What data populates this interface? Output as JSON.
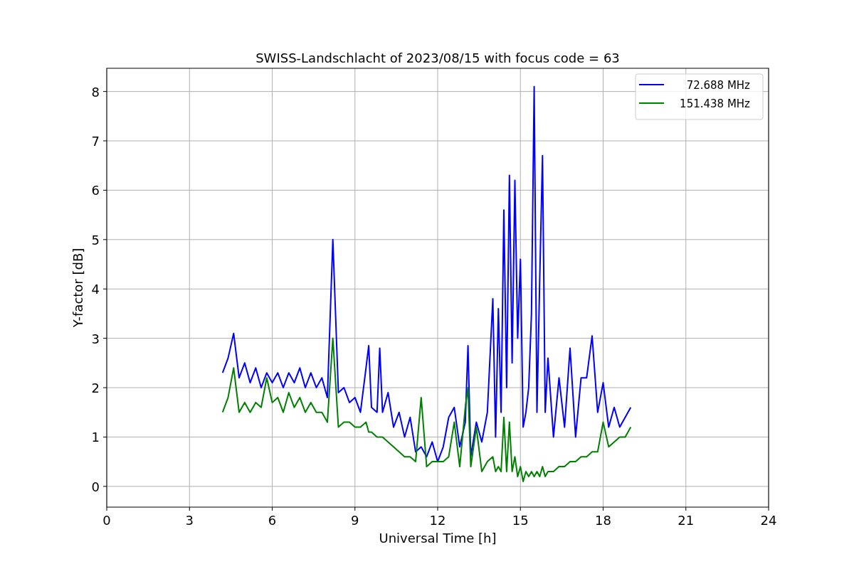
{
  "plot": {
    "chart_data": {
      "type": "line",
      "title": "SWISS-Landschlacht of 2023/08/15 with focus code = 63",
      "xlabel": "Universal Time [h]",
      "ylabel": "Y-factor [dB]",
      "x": [
        4.2,
        4.4,
        4.6,
        4.8,
        5.0,
        5.2,
        5.4,
        5.6,
        5.8,
        6.0,
        6.2,
        6.4,
        6.6,
        6.8,
        7.0,
        7.2,
        7.4,
        7.6,
        7.8,
        8.0,
        8.2,
        8.4,
        8.6,
        8.8,
        9.0,
        9.2,
        9.4,
        9.5,
        9.6,
        9.8,
        9.9,
        10.0,
        10.2,
        10.4,
        10.6,
        10.8,
        11.0,
        11.2,
        11.4,
        11.6,
        11.8,
        12.0,
        12.2,
        12.4,
        12.6,
        12.8,
        13.0,
        13.1,
        13.2,
        13.4,
        13.6,
        13.8,
        14.0,
        14.1,
        14.2,
        14.3,
        14.4,
        14.5,
        14.6,
        14.7,
        14.8,
        14.9,
        15.0,
        15.1,
        15.2,
        15.3,
        15.4,
        15.5,
        15.6,
        15.7,
        15.8,
        15.9,
        16.0,
        16.2,
        16.4,
        16.6,
        16.8,
        17.0,
        17.2,
        17.4,
        17.6,
        17.8,
        18.0,
        18.2,
        18.4,
        18.6,
        18.8,
        19.0
      ],
      "series": [
        {
          "name": "72.688 MHz",
          "color": "#0000ff",
          "values": [
            2.3,
            2.6,
            3.1,
            2.2,
            2.5,
            2.1,
            2.4,
            2.0,
            2.3,
            2.1,
            2.3,
            2.0,
            2.3,
            2.1,
            2.4,
            2.0,
            2.3,
            2.0,
            2.2,
            1.8,
            5.0,
            1.9,
            2.0,
            1.7,
            1.8,
            1.5,
            2.4,
            2.85,
            1.6,
            1.5,
            2.8,
            1.5,
            1.9,
            1.2,
            1.5,
            1.0,
            1.4,
            0.7,
            0.8,
            0.6,
            0.9,
            0.5,
            0.8,
            1.4,
            1.6,
            0.8,
            1.3,
            2.85,
            0.6,
            1.3,
            0.9,
            1.5,
            3.8,
            1.0,
            3.6,
            1.5,
            5.6,
            2.0,
            6.3,
            2.5,
            6.2,
            3.0,
            4.6,
            1.2,
            1.5,
            2.0,
            3.5,
            8.1,
            1.5,
            4.2,
            6.7,
            1.5,
            2.6,
            1.0,
            2.2,
            1.2,
            2.8,
            1.0,
            2.2,
            2.2,
            3.05,
            1.5,
            2.1,
            1.2,
            1.6,
            1.2,
            1.4,
            1.6
          ]
        },
        {
          "name": "151.438 MHz",
          "color": "#008000",
          "values": [
            1.5,
            1.8,
            2.4,
            1.5,
            1.7,
            1.5,
            1.7,
            1.6,
            2.2,
            1.7,
            1.8,
            1.5,
            1.9,
            1.6,
            1.8,
            1.5,
            1.7,
            1.5,
            1.5,
            1.3,
            3.0,
            1.2,
            1.3,
            1.3,
            1.2,
            1.2,
            1.3,
            1.1,
            1.1,
            1.0,
            1.0,
            1.0,
            0.9,
            0.8,
            0.7,
            0.6,
            0.6,
            0.5,
            1.8,
            0.4,
            0.5,
            0.5,
            0.5,
            0.6,
            1.3,
            0.4,
            1.6,
            2.0,
            0.4,
            1.2,
            0.3,
            0.5,
            0.6,
            0.3,
            0.4,
            0.3,
            1.4,
            0.3,
            1.3,
            0.3,
            0.6,
            0.2,
            0.4,
            0.1,
            0.3,
            0.2,
            0.3,
            0.2,
            0.3,
            0.2,
            0.4,
            0.2,
            0.3,
            0.3,
            0.4,
            0.4,
            0.5,
            0.5,
            0.6,
            0.6,
            0.7,
            0.7,
            1.3,
            0.8,
            0.9,
            1.0,
            1.0,
            1.2
          ]
        }
      ],
      "xlim": [
        0,
        24
      ],
      "ylim": [
        -0.42,
        8.47
      ],
      "xticks": [
        0,
        3,
        6,
        9,
        12,
        15,
        18,
        21,
        24
      ],
      "yticks": [
        0,
        1,
        2,
        3,
        4,
        5,
        6,
        7,
        8
      ],
      "grid": true,
      "legend": true
    }
  }
}
